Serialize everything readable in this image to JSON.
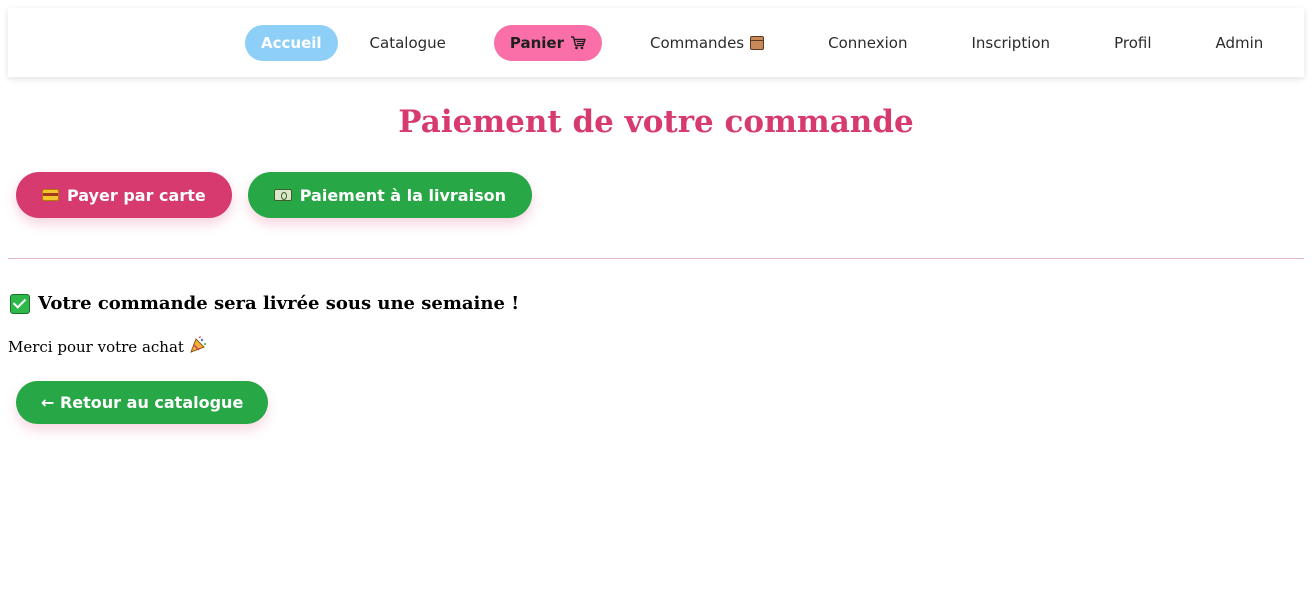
{
  "nav": {
    "items": [
      {
        "label": "Accueil"
      },
      {
        "label": "Catalogue"
      },
      {
        "label": "Panier"
      },
      {
        "label": "Commandes"
      },
      {
        "label": "Connexion"
      },
      {
        "label": "Inscription"
      },
      {
        "label": "Profil"
      },
      {
        "label": "Admin"
      }
    ],
    "icons": {
      "cart": "shopping-cart-icon",
      "orders": "package-icon"
    }
  },
  "page": {
    "title": "Paiement de votre commande"
  },
  "payment": {
    "card_label": "Payer par carte",
    "card_icon": "credit-card-icon",
    "cod_label": "Paiement à la livraison",
    "cod_icon": "banknote-icon"
  },
  "confirmation": {
    "message": "Votre commande sera livrée sous une semaine !",
    "icon": "check-mark-icon",
    "thanks": "Merci pour votre achat",
    "thanks_icon": "party-popper-icon"
  },
  "back": {
    "label": "← Retour au catalogue"
  },
  "colors": {
    "primary_pink": "#d63a6e",
    "green": "#27a745",
    "nav_home": "#8ecff8",
    "nav_cart": "#fb6fa8"
  }
}
